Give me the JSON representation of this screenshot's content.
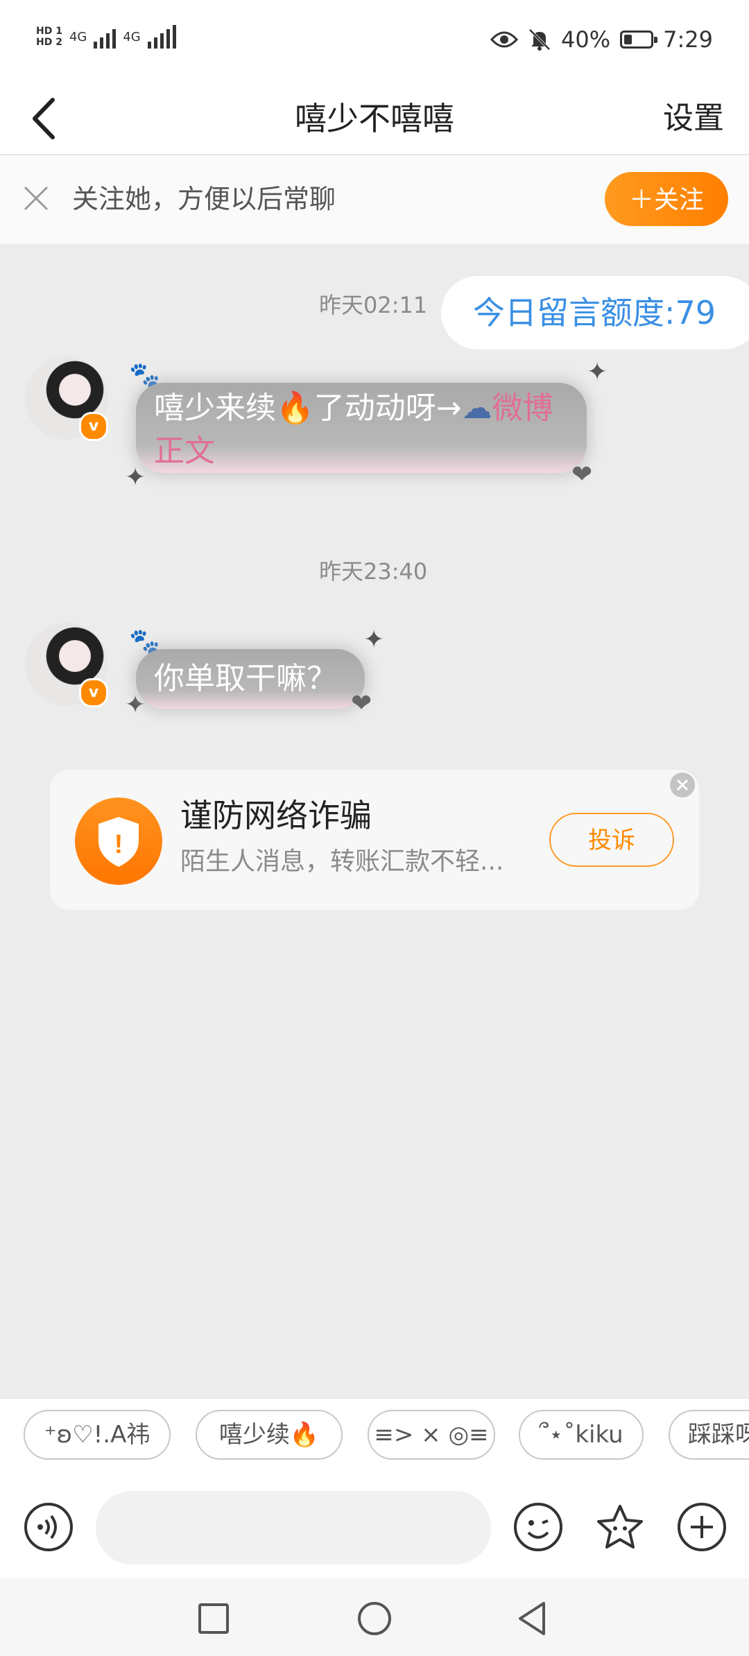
{
  "status_bar": {
    "hd1": "HD 1",
    "hd2": "HD 2",
    "net1": "4G",
    "net2": "4G",
    "battery_percent": "40%",
    "battery_level": 0.4,
    "time": "7:29"
  },
  "header": {
    "title": "嘻少不嘻嘻",
    "settings_label": "设置"
  },
  "follow_bar": {
    "text": "关注她，方便以后常聊",
    "button_label": "＋关注"
  },
  "chat": {
    "time1": "昨天02:11",
    "quota": "今日留言额度:79",
    "msg1_text": "嘻少来续🔥了动动呀→",
    "msg1_link": "微博正文",
    "time2": "昨天23:40",
    "msg2_text": "你单取干嘛？",
    "verified_badge": "v"
  },
  "fraud_card": {
    "title": "谨防网络诈骗",
    "desc": "陌生人消息，转账汇款不轻...",
    "button_label": "投诉",
    "icon_glyph": "!"
  },
  "quick_replies": [
    "⁺ʚ♡!.A祎",
    "嘻少续🔥",
    "≡> × ◎≡",
    "՞⋆˚kiku",
    "踩踩呀"
  ],
  "colors": {
    "accent": "#ff8a00",
    "link": "#3a8fe4",
    "pink_link": "#e06e96"
  }
}
